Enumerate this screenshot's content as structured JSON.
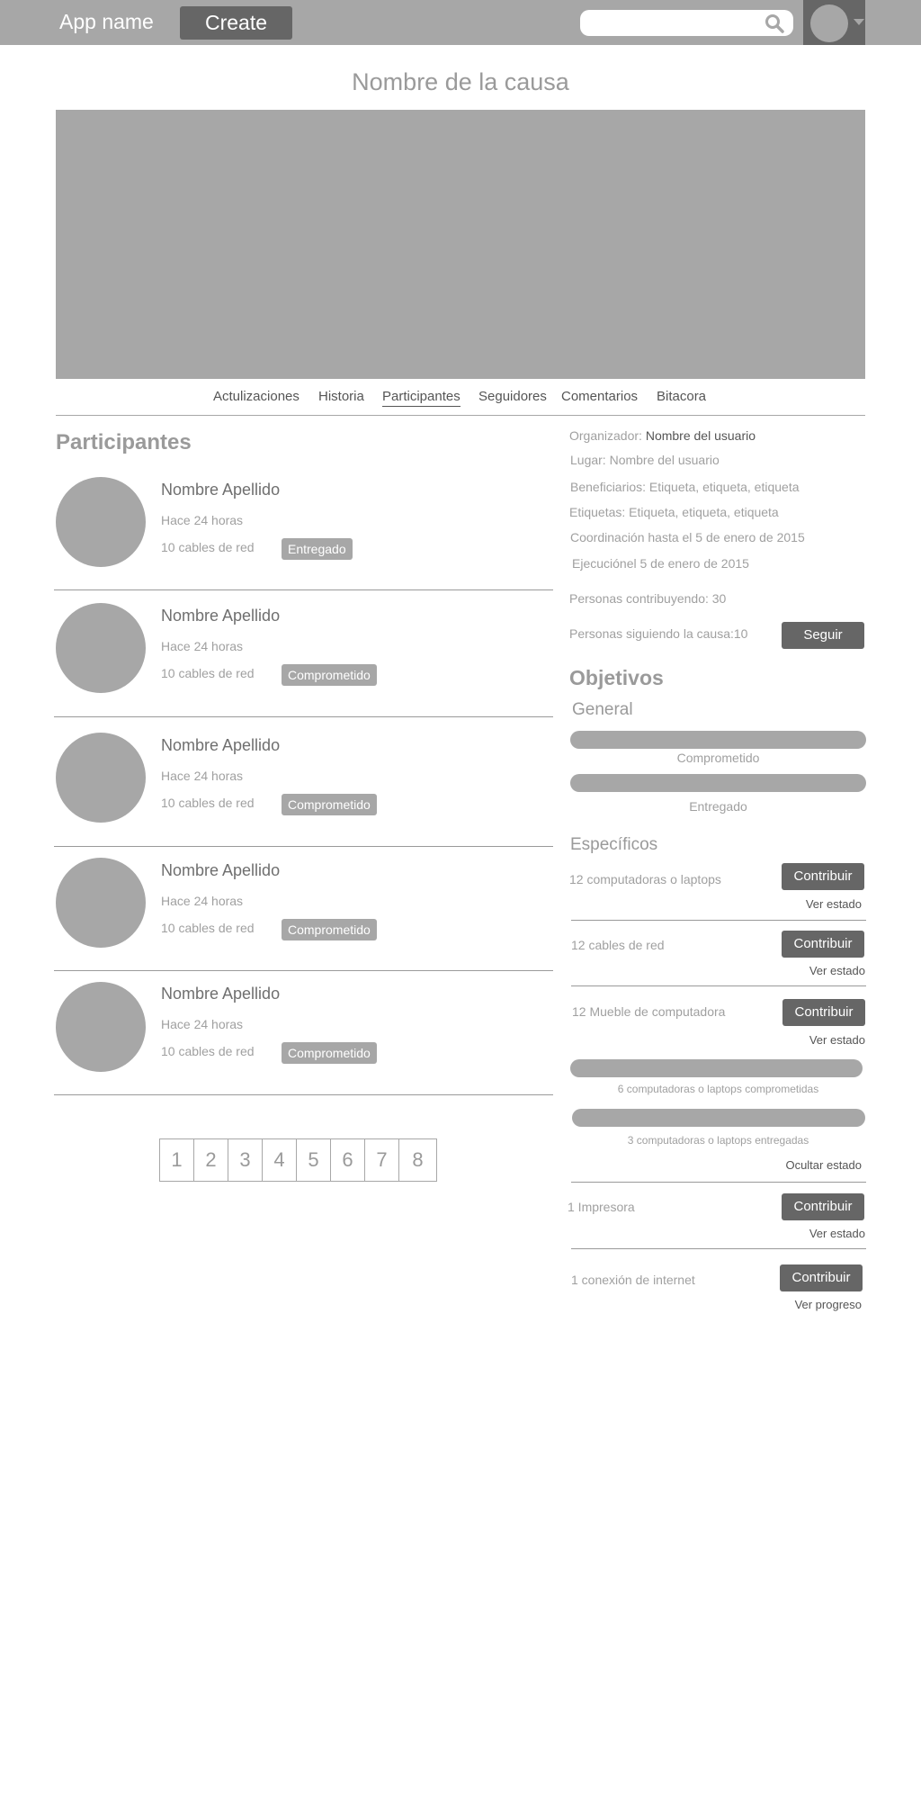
{
  "header": {
    "app_name": "App name",
    "create_label": "Create",
    "search_value": "",
    "search_icon": "search-icon",
    "avatar_icon": "user-avatar",
    "menu_icon": "chevron-down-icon"
  },
  "cause": {
    "title": "Nombre de la causa"
  },
  "tabs": [
    {
      "label": "Actulizaciones"
    },
    {
      "label": "Historia"
    },
    {
      "label": "Participantes",
      "active": true
    },
    {
      "label": "Seguidores"
    },
    {
      "label": "Comentarios"
    },
    {
      "label": "Bitacora"
    }
  ],
  "participants_section": {
    "title": "Participantes",
    "items": [
      {
        "name": "Nombre Apellido",
        "time": "Hace 24 horas",
        "item": "10 cables de red",
        "status": "Entregado"
      },
      {
        "name": "Nombre Apellido",
        "time": "Hace 24 horas",
        "item": "10 cables de red",
        "status": "Comprometido"
      },
      {
        "name": "Nombre Apellido",
        "time": "Hace 24 horas",
        "item": "10 cables de red",
        "status": "Comprometido"
      },
      {
        "name": "Nombre Apellido",
        "time": "Hace 24 horas",
        "item": "10 cables de red",
        "status": "Comprometido"
      },
      {
        "name": "Nombre Apellido",
        "time": "Hace 24 horas",
        "item": "10 cables de red",
        "status": "Comprometido"
      }
    ]
  },
  "pagination": [
    "1",
    "2",
    "3",
    "4",
    "5",
    "6",
    "7",
    "8"
  ],
  "details": {
    "organizer_label": "Organizador:",
    "organizer_value": "Nombre del usuario",
    "place": "Lugar: Nombre del usuario",
    "beneficiaries": "Beneficiarios: Etiqueta, etiqueta, etiqueta",
    "tags": "Etiquetas: Etiqueta, etiqueta, etiqueta",
    "coordination": "Coordinación hasta el 5 de enero de 2015",
    "execution": "Ejecuciónel 5 de enero de 2015",
    "contributors": "Personas contribuyendo: 30",
    "followers": "Personas siguiendo la causa:10",
    "follow_label": "Seguir"
  },
  "objectives": {
    "title": "Objetivos",
    "general": {
      "title": "General",
      "committed_label": "Comprometido",
      "delivered_label": "Entregado"
    },
    "specific": {
      "title": "Específicos",
      "contribute_label": "Contribuir",
      "items": [
        {
          "name": "12 computadoras o laptops",
          "link": "Ver estado"
        },
        {
          "name": "12 cables de red",
          "link": "Ver estado"
        },
        {
          "name": "12 Mueble de computadora",
          "link": "Ver estado"
        },
        {
          "name": "1 Impresora",
          "link": "Ver estado"
        },
        {
          "name": "1 conexión de internet",
          "link": "Ver progreso"
        }
      ],
      "expanded": {
        "committed_label": "6 computadoras o laptops comprometidas",
        "delivered_label": "3 computadoras o laptops entregadas",
        "hide_link": "Ocultar estado"
      }
    }
  }
}
